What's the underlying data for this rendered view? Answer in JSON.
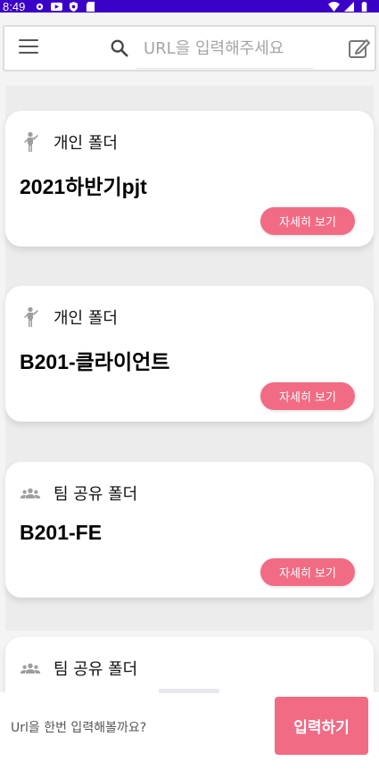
{
  "status_bar": {
    "time": "8:49",
    "left_icons": [
      "gear-icon",
      "play-icon",
      "shield-icon",
      "sd-card-icon"
    ],
    "right_icons": [
      "wifi-icon",
      "signal-icon",
      "battery-icon"
    ]
  },
  "header": {
    "menu_icon": "hamburger-menu-icon",
    "search_icon": "search-icon",
    "search_placeholder": "URL을 입력해주세요",
    "edit_icon": "edit-icon"
  },
  "folders": [
    {
      "type_label": "개인 폴더",
      "icon": "person-icon",
      "title": "2021하반기pjt",
      "button_label": "자세히 보기"
    },
    {
      "type_label": "개인 폴더",
      "icon": "person-icon",
      "title": "B201-클라이언트",
      "button_label": "자세히 보기"
    },
    {
      "type_label": "팀 공유 폴더",
      "icon": "group-icon",
      "title": "B201-FE",
      "button_label": "자세히 보기"
    },
    {
      "type_label": "팀 공유 폴더",
      "icon": "group-icon"
    }
  ],
  "bottom_bar": {
    "prompt": "Url을 한번 입력해볼까요?",
    "submit_label": "입력하기"
  },
  "colors": {
    "status_bar": "#3a00c8",
    "accent": "#f26b84",
    "icon_gray": "#9e9e9e"
  }
}
